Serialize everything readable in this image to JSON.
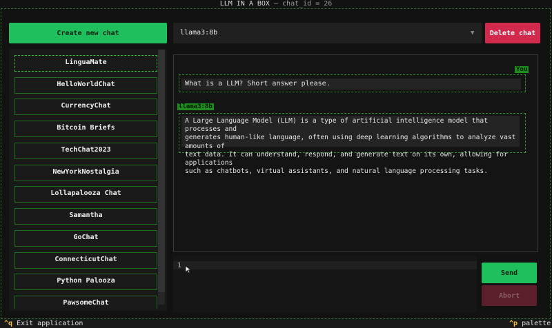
{
  "window": {
    "title": "LLM IN A BOX",
    "subtitle": "— chat_id = 26"
  },
  "sidebar": {
    "new_chat_label": "Create new chat",
    "items": [
      {
        "label": "LinguaMate",
        "active": true
      },
      {
        "label": "HelloWorldChat"
      },
      {
        "label": "CurrencyChat"
      },
      {
        "label": "Bitcoin Briefs"
      },
      {
        "label": "TechChat2023"
      },
      {
        "label": "NewYorkNostalgia"
      },
      {
        "label": "Lollapalooza Chat"
      },
      {
        "label": "Samantha"
      },
      {
        "label": "GoChat"
      },
      {
        "label": "ConnecticutChat"
      },
      {
        "label": "Python Palooza"
      },
      {
        "label": "PawsomeChat"
      }
    ]
  },
  "header": {
    "model_selected": "llama3:8b",
    "delete_label": "Delete chat"
  },
  "conversation": {
    "user_role": "You",
    "user_message": "What is a LLM? Short answer please.",
    "bot_role": "llama3:8b",
    "bot_message": "A Large Language Model (LLM) is a type of artificial intelligence model that processes and\ngenerates human-like language, often using deep learning algorithms to analyze vast amounts of\ntext data. It can understand, respond, and generate text on its own, allowing for applications\nsuch as chatbots, virtual assistants, and natural language processing tasks."
  },
  "input": {
    "line_number": "1",
    "value": ""
  },
  "actions": {
    "send_label": "Send",
    "abort_label": "Abort"
  },
  "footer": {
    "quit_key": "^q",
    "quit_label": "Exit application",
    "palette_key": "^p",
    "palette_label": "palette"
  },
  "colors": {
    "accent_green": "#1fbf5d",
    "danger_red": "#d2294d",
    "border_green": "#1e6f1e"
  }
}
